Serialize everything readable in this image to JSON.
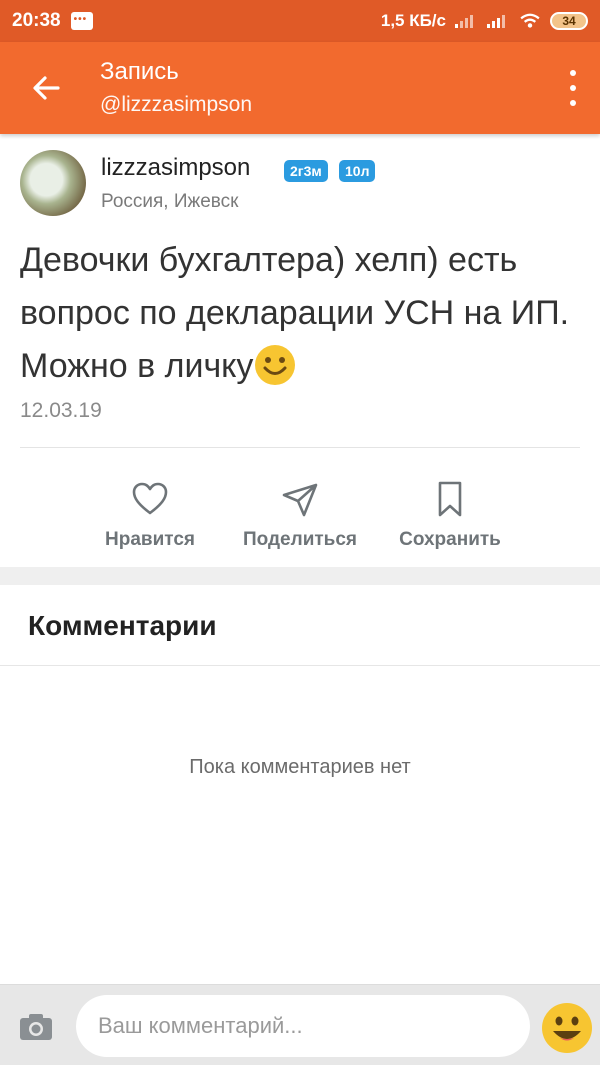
{
  "status_bar": {
    "time": "20:38",
    "net_speed": "1,5 КБ/с",
    "battery": "34"
  },
  "app_bar": {
    "title": "Запись",
    "subtitle": "@lizzzasimpson"
  },
  "post": {
    "username": "lizzzasimpson",
    "badges": [
      "2г3м",
      "10л"
    ],
    "location": "Россия, Ижевск",
    "text": "Девочки бухгалтера) хелп) есть вопрос по декларации УСН на ИП. Можно в личку",
    "date": "12.03.19"
  },
  "actions": {
    "like": "Нравится",
    "share": "Поделиться",
    "save": "Сохранить"
  },
  "comments": {
    "title": "Комментарии",
    "empty": "Пока комментариев нет"
  },
  "composer": {
    "placeholder": "Ваш комментарий..."
  },
  "colors": {
    "accent": "#f26a2e",
    "status_bar": "#e05a27",
    "badge": "#2b9be0"
  }
}
